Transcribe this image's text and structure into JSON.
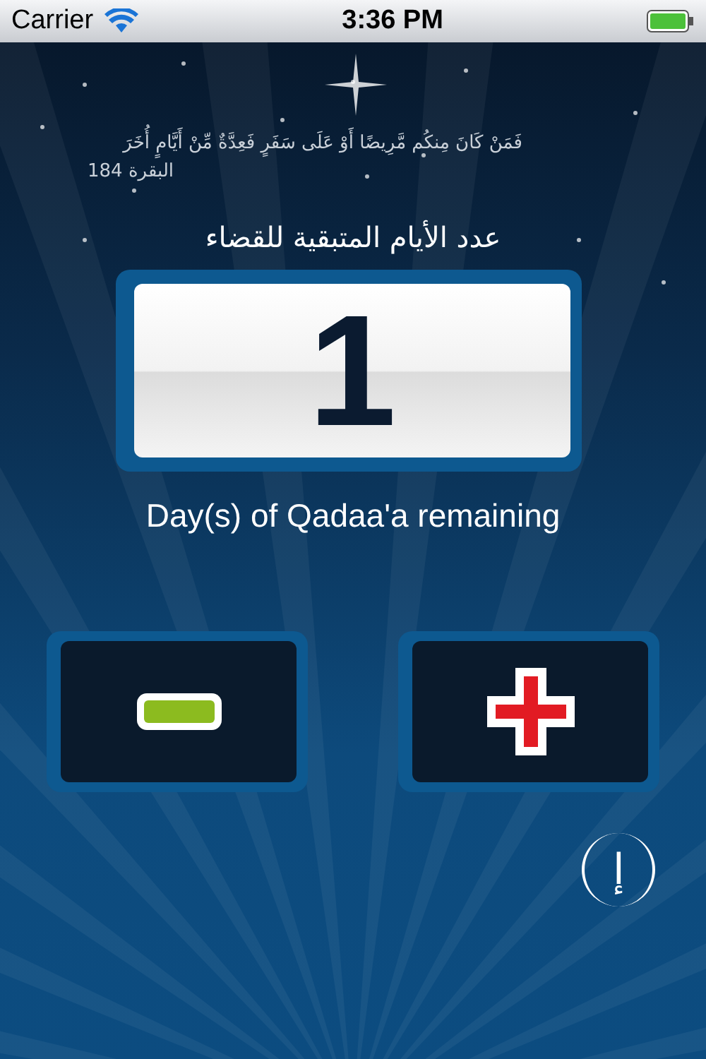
{
  "status_bar": {
    "carrier": "Carrier",
    "time": "3:36 PM"
  },
  "verse": {
    "text": "فَمَنْ كَانَ مِنكُم مَّرِيضًا أَوْ عَلَى سَفَرٍ فَعِدَّةٌ مِّنْ أَيَّامٍ أُخَرَ",
    "reference": "البقرة 184"
  },
  "counter": {
    "title": "عدد الأيام المتبقية للقضاء",
    "value": "1",
    "caption": "Day(s) of Qadaa'a remaining"
  },
  "buttons": [
    {
      "kind": "minus"
    },
    {
      "kind": "plus"
    }
  ],
  "info_button": {
    "label": "إ"
  }
}
